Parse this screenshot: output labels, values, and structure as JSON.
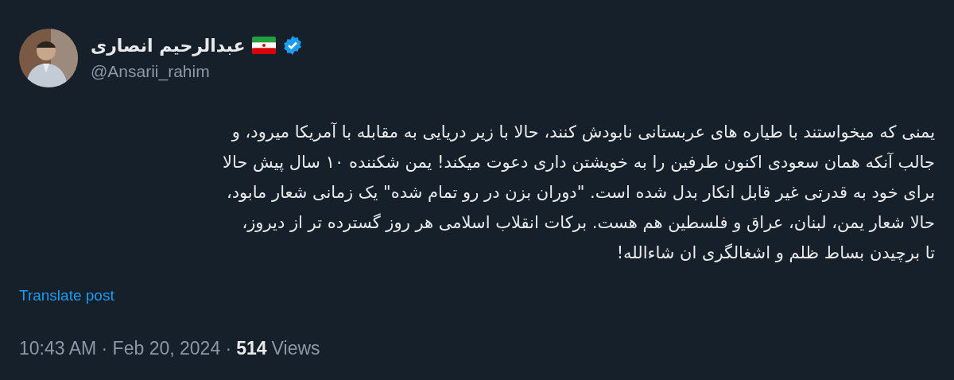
{
  "author": {
    "name": "عبدالرحیم انصاری",
    "handle": "@Ansarii_rahim",
    "verified": true
  },
  "text_lines": [
    "یمنی که میخواستند با طیاره های عربستانی نابودش کنند، حالا با زیر دریایی به مقابله با آمریکا میرود، و",
    "جالب آنکه همان سعودی اکنون طرفین را به خویشتن داری دعوت میکند! یمن شکننده ۱۰ سال پیش حالا",
    "برای خود به قدرتی غیر قابل انکار بدل شده است. \"دوران بزن در رو تمام شده\" یک زمانی شعار مابود،",
    "حالا شعار یمن، لبنان، عراق و فلسطین هم هست. برکات انقلاب اسلامی هر روز گسترده تر از دیروز،",
    "تا برچیدن بساط ظلم و اشغالگری ان شاءالله!"
  ],
  "translate_link": "Translate post",
  "meta": {
    "timestamp": "10:43 AM · Feb 20, 2024 ·",
    "views_count": "514",
    "views_label": "Views"
  }
}
